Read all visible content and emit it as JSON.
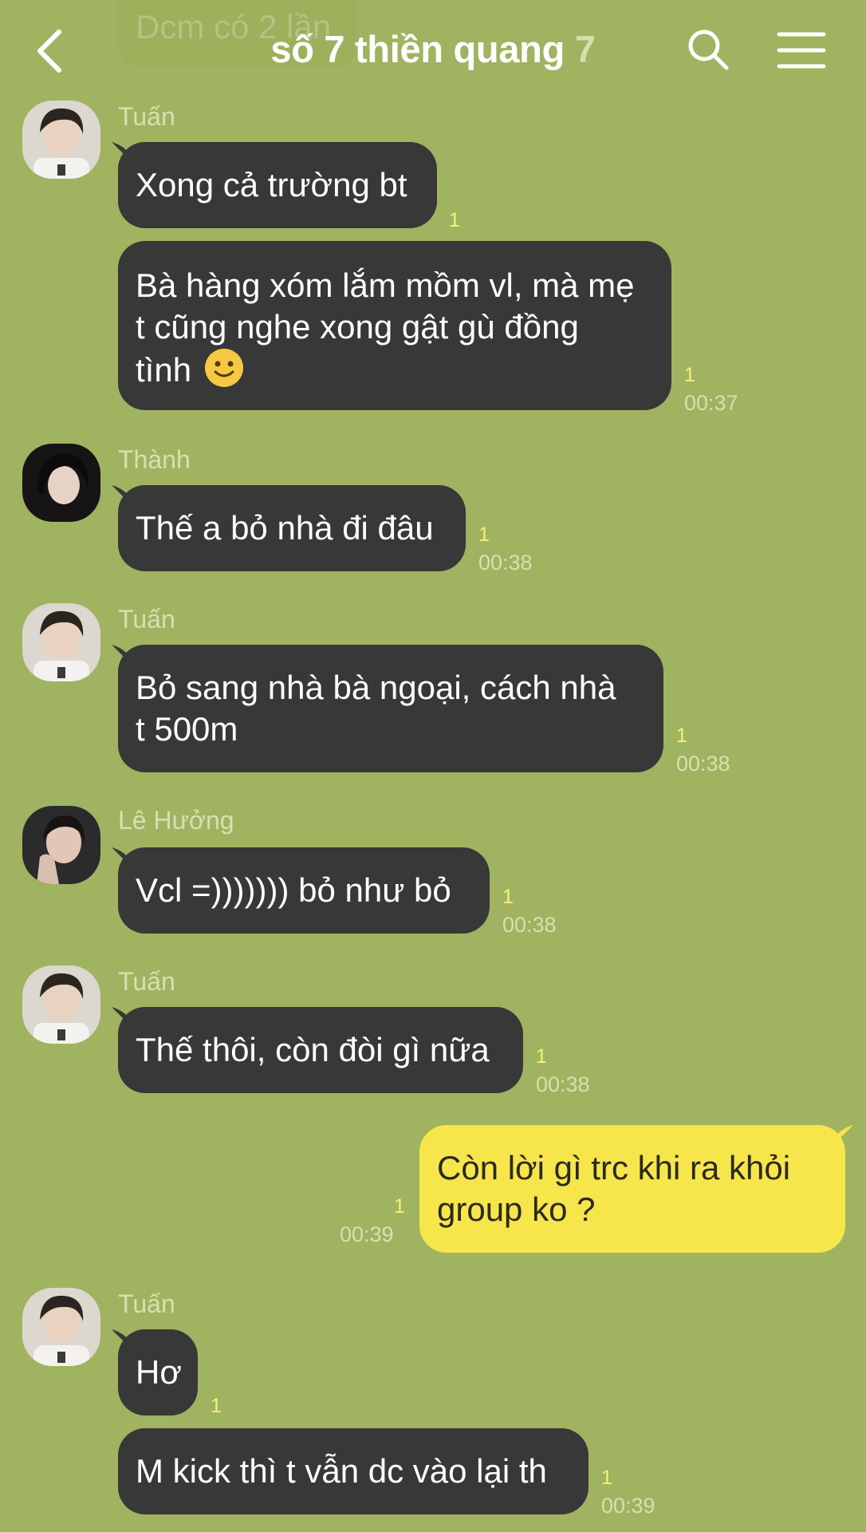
{
  "header": {
    "title": "số 7 thiền quang",
    "member_count": "7",
    "back_icon": "chevron-left-icon",
    "search_icon": "search-icon",
    "menu_icon": "hamburger-menu-icon"
  },
  "peek_message": {
    "text": "Dcm có 2 lần"
  },
  "messages": [
    {
      "sender": "Tuấn",
      "text": "Xong cả trường bt",
      "unread": "1",
      "time": ""
    },
    {
      "sender": "",
      "lines": [
        "Bà hàng xóm lắm mồm vl, mà mẹ",
        "t cũng nghe xong gật gù đồng",
        "tình"
      ],
      "emoji": "slightly-smiling-face",
      "unread": "1",
      "time": "00:37"
    },
    {
      "sender": "Thành",
      "text": "Thế a bỏ nhà đi đâu",
      "unread": "1",
      "time": "00:38"
    },
    {
      "sender": "Tuấn",
      "lines": [
        "Bỏ sang nhà bà ngoại, cách nhà",
        "t 500m"
      ],
      "unread": "1",
      "time": "00:38"
    },
    {
      "sender": "Lê Hưởng",
      "text": "Vcl =))))))) bỏ như bỏ",
      "unread": "1",
      "time": "00:38"
    },
    {
      "sender": "Tuấn",
      "text": "Thế thôi, còn đòi gì nữa",
      "unread": "1",
      "time": "00:38"
    },
    {
      "sender": "me",
      "lines": [
        "Còn lời gì trc khi ra khỏi",
        "group ko ?"
      ],
      "unread": "1",
      "time": "00:39"
    },
    {
      "sender": "Tuấn",
      "text": "Hơ",
      "unread": "1",
      "time": ""
    },
    {
      "sender": "",
      "text": "M kick thì t vẫn dc vào lại th",
      "unread": "1",
      "time": "00:39"
    }
  ],
  "colors": {
    "background": "#a0b360",
    "incoming_bubble": "#383838",
    "outgoing_bubble": "#f7e54c",
    "unread_count": "#f6f07a"
  }
}
